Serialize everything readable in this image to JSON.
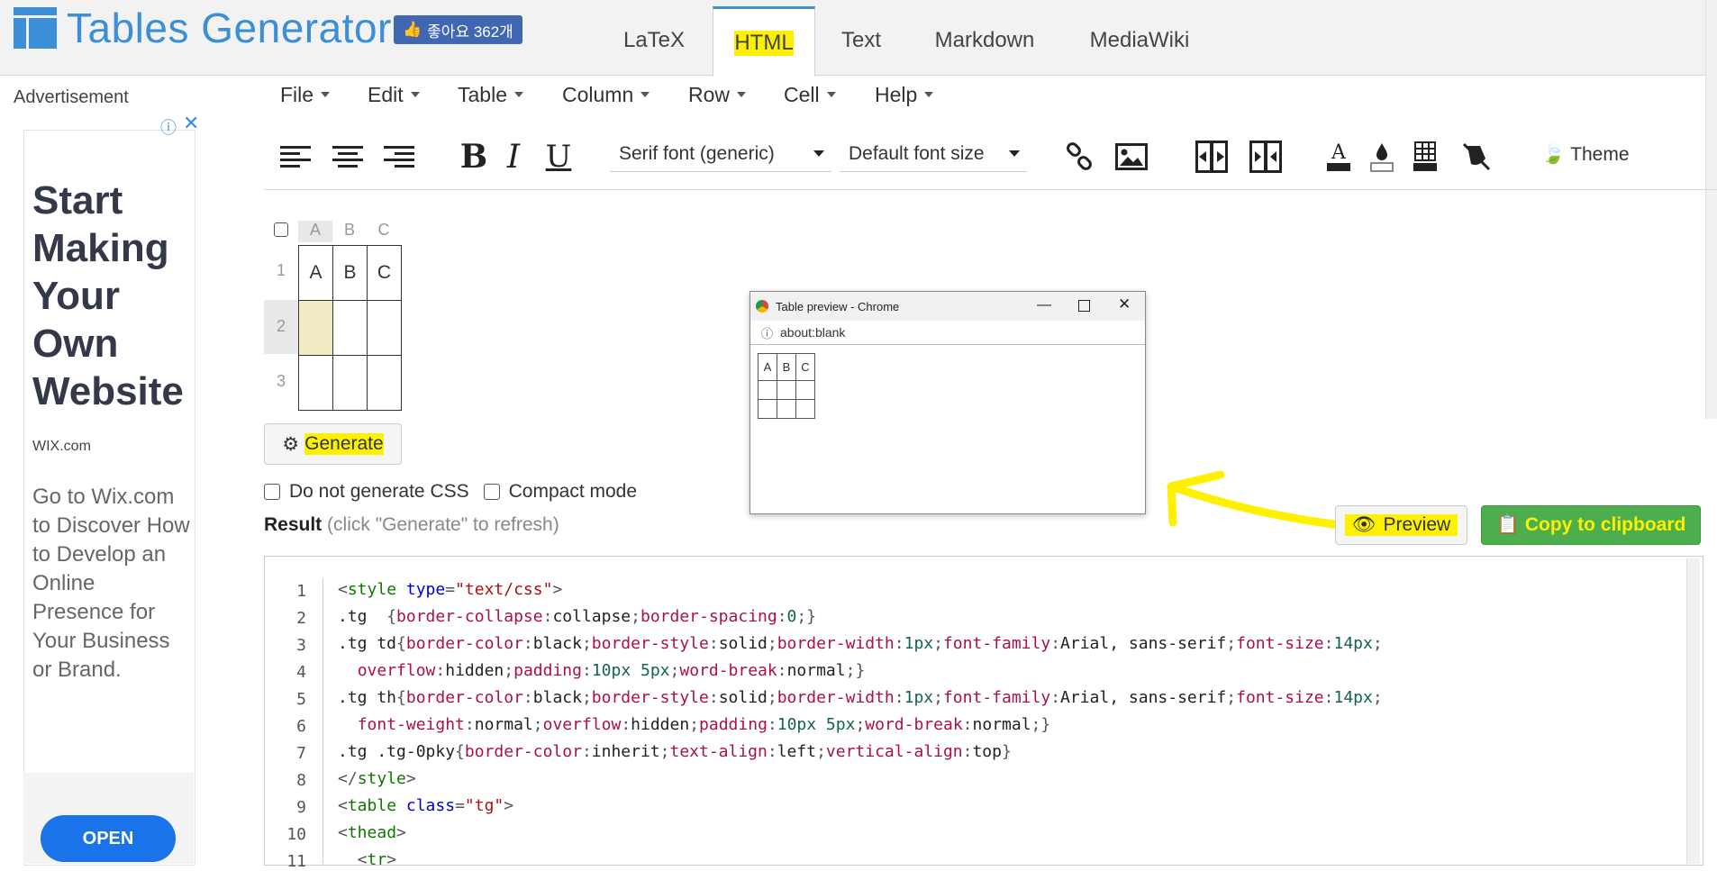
{
  "app": {
    "logo_text": "Tables Generator",
    "fb_like_label": "좋아요 362개"
  },
  "tabs": [
    {
      "label": "LaTeX"
    },
    {
      "label": "HTML",
      "active": true
    },
    {
      "label": "Text"
    },
    {
      "label": "Markdown"
    },
    {
      "label": "MediaWiki"
    }
  ],
  "ad": {
    "label": "Advertisement",
    "headline": "Start Making Your Own Website",
    "brand": "WIX.com",
    "description": "Go to Wix.com to Discover How to Develop an Online Presence for Your Business or Brand.",
    "open_label": "OPEN"
  },
  "menu": [
    "File",
    "Edit",
    "Table",
    "Column",
    "Row",
    "Cell",
    "Help"
  ],
  "toolbar": {
    "font_family": "Serif font (generic)",
    "font_size": "Default font size",
    "theme_label": "Theme",
    "bold": "B",
    "italic": "I",
    "underline": "U"
  },
  "grid": {
    "col_headers": [
      "A",
      "B",
      "C"
    ],
    "row_headers": [
      "1",
      "2",
      "3"
    ],
    "cells": [
      [
        "A",
        "B",
        "C"
      ],
      [
        "",
        "",
        ""
      ],
      [
        "",
        "",
        ""
      ]
    ]
  },
  "generate_label": "Generate",
  "options": {
    "no_css": "Do not generate CSS",
    "compact": "Compact mode"
  },
  "result": {
    "label": "Result",
    "hint": "(click \"Generate\" to refresh)"
  },
  "preview_window": {
    "title": "Table preview - Chrome",
    "url": "about:blank",
    "cells": [
      [
        "A",
        "B",
        "C"
      ],
      [
        "",
        "",
        ""
      ],
      [
        "",
        "",
        ""
      ]
    ]
  },
  "buttons": {
    "preview": "Preview",
    "copy": "Copy to clipboard"
  },
  "code_lines": [
    "1",
    "2",
    "3",
    "4",
    "5",
    "6",
    "7",
    "8",
    "9",
    "10",
    "11"
  ],
  "colors": {
    "accent": "#3a8fd6",
    "highlight": "#fdf100",
    "copy_green": "#4cae4c",
    "ad_button": "#1a73e8"
  }
}
